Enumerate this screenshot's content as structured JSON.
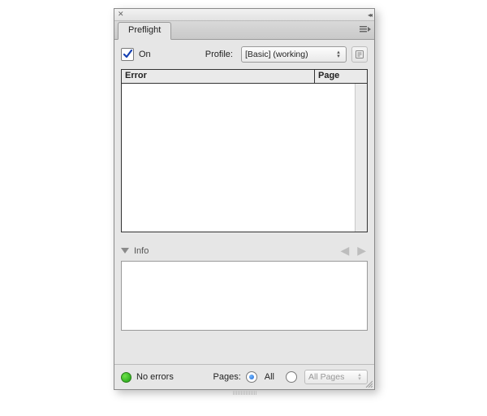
{
  "tab": {
    "title": "Preflight"
  },
  "toolbar": {
    "on_label": "On",
    "on_checked": true,
    "profile_label": "Profile:",
    "profile_value": "[Basic] (working)"
  },
  "table": {
    "col_error": "Error",
    "col_page": "Page"
  },
  "info": {
    "label": "Info"
  },
  "status": {
    "text": "No errors",
    "color": "#1a9e12"
  },
  "pages": {
    "label": "Pages:",
    "option_all": "All",
    "range_value": "All Pages",
    "selected": "all"
  }
}
